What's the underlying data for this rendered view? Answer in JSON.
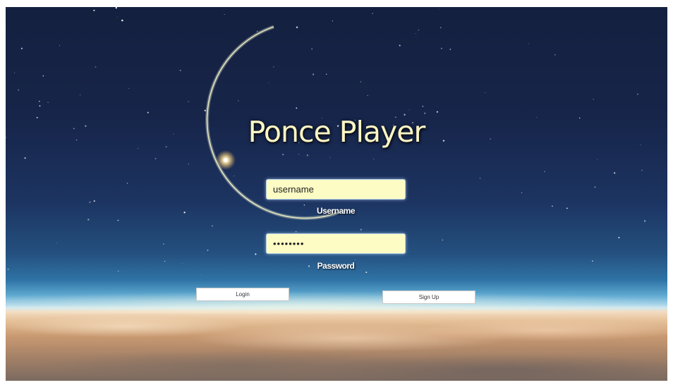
{
  "app": {
    "title": "Ponce Player"
  },
  "login_form": {
    "username": {
      "value": "username",
      "label": "Username"
    },
    "password": {
      "value": "••••••••",
      "label": "Password"
    },
    "login_label": "Login",
    "signup_label": "Sign Up"
  },
  "colors": {
    "title": "#fdf6c3",
    "input_background": "#fdfcc4",
    "button_background": "#ffffff",
    "sky_top": "#14203f",
    "horizon": "#9fd0e8"
  }
}
